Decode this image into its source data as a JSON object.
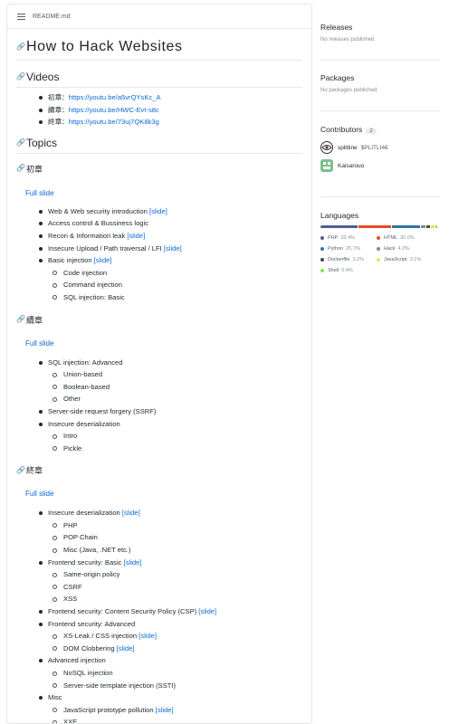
{
  "readme": {
    "filename": "README.md",
    "title": "How to Hack Websites",
    "videos_heading": "Videos",
    "videos": [
      {
        "label": "初章：",
        "url": "https://youtu.be/a5vrQYsKc_A"
      },
      {
        "label": "續章：",
        "url": "https://youtu.be/HWC-Evt-s8c"
      },
      {
        "label": "終章：",
        "url": "https://youtu.be/73uj7QK8k3g"
      }
    ],
    "topics_heading": "Topics",
    "full_slide": "Full slide",
    "slide": "[slide]",
    "ch1": {
      "heading": "初章",
      "items": [
        {
          "text": "Web & Web security introduction",
          "slide": true
        },
        {
          "text": "Access control & Bussiness logic",
          "slide": false
        },
        {
          "text": "Recon & Information leak",
          "slide": true
        },
        {
          "text": "Insecure Upload / Path traversal / LFI",
          "slide": true
        },
        {
          "text": "Basic injection",
          "slide": true,
          "sub": [
            "Code injection",
            "Command injection",
            "SQL injection: Basic"
          ]
        }
      ]
    },
    "ch2": {
      "heading": "續章",
      "items": [
        {
          "text": "SQL injection: Advanced",
          "slide": false,
          "sub": [
            "Union-based",
            "Boolean-based",
            "Other"
          ]
        },
        {
          "text": "Server-side request forgery (SSRF)",
          "slide": false
        },
        {
          "text": "Insecure deserialization",
          "slide": false,
          "sub": [
            "Intro",
            "Pickle"
          ]
        }
      ]
    },
    "ch3": {
      "heading": "終章",
      "items": [
        {
          "text": "Insecure deserialization",
          "slide": true,
          "sub": [
            "PHP",
            "POP Chain",
            "Misc (Java, .NET etc.)"
          ]
        },
        {
          "text": "Frontend security: Basic",
          "slide": true,
          "sub": [
            "Same-origin policy",
            "CSRF",
            "XSS"
          ]
        },
        {
          "text": "Frontend security: Content Security Policy (CSP)",
          "slide": true
        },
        {
          "text": "Frontend security: Advanced",
          "slide": false,
          "subs": [
            {
              "text": "XS-Leak / CSS injection",
              "slide": true
            },
            {
              "text": "DOM Clobbering",
              "slide": true
            }
          ]
        },
        {
          "text": "Advanced injection",
          "slide": false,
          "sub": [
            "NoSQL injection",
            "Server-side template injection (SSTI)"
          ]
        },
        {
          "text": "Misc",
          "slide": false,
          "subs": [
            {
              "text": "JavaScript prototype pollution",
              "slide": true
            },
            {
              "text": "XXE",
              "slide": false
            }
          ]
        }
      ]
    }
  },
  "sidebar": {
    "releases": {
      "title": "Releases",
      "empty": "No releases published"
    },
    "packages": {
      "title": "Packages",
      "empty": "No packages published"
    },
    "contributors": {
      "title": "Contributors",
      "count": "2",
      "people": [
        {
          "name": "splitline",
          "alias": "$PLITLI4€",
          "avatar_color": "#333333"
        },
        {
          "name": "Kaisarouo",
          "alias": "",
          "avatar_color": "#7cbf8a"
        }
      ]
    },
    "languages": {
      "title": "Languages",
      "items": [
        {
          "name": "PHP",
          "percent": "33.4%",
          "value": 33.4,
          "color": "#4F5D95"
        },
        {
          "name": "HTML",
          "percent": "30.0%",
          "value": 30.0,
          "color": "#e34c26"
        },
        {
          "name": "Python",
          "percent": "25.7%",
          "value": 25.7,
          "color": "#3572A5"
        },
        {
          "name": "Hack",
          "percent": "4.2%",
          "value": 4.2,
          "color": "#878787"
        },
        {
          "name": "Dockerfile",
          "percent": "3.2%",
          "value": 3.2,
          "color": "#384d54"
        },
        {
          "name": "JavaScript",
          "percent": "3.1%",
          "value": 3.1,
          "color": "#f1e05a"
        },
        {
          "name": "Shell",
          "percent": "0.4%",
          "value": 0.4,
          "color": "#89e051"
        }
      ]
    }
  }
}
